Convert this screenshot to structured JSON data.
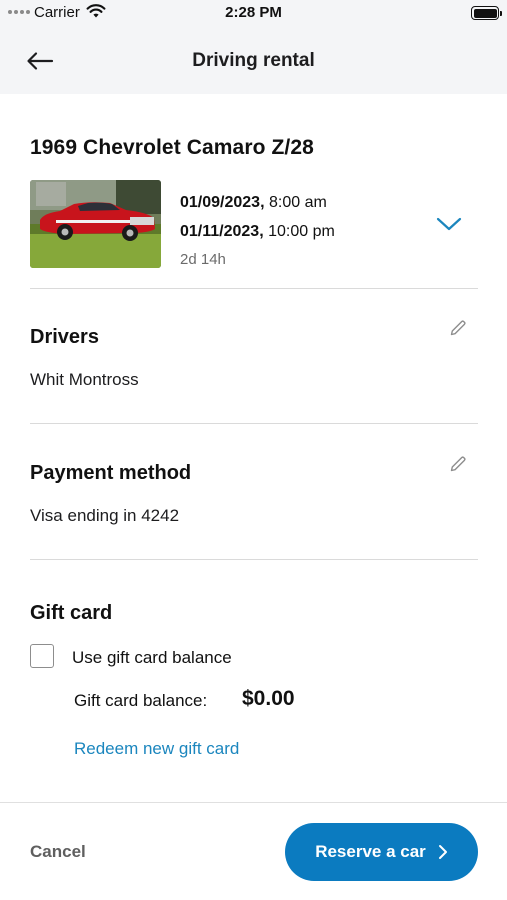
{
  "status_bar": {
    "carrier": "Carrier",
    "time": "2:28 PM"
  },
  "nav": {
    "title": "Driving rental",
    "back_icon": "arrow-left-icon"
  },
  "rental": {
    "car_name": "1969 Chevrolet Camaro Z/28",
    "pickup_date": "01/09/2023,",
    "pickup_time": " 8:00 am",
    "return_date": "01/11/2023,",
    "return_time": " 10:00 pm",
    "duration": "2d 14h",
    "expand_icon": "chevron-down-icon"
  },
  "drivers": {
    "title": "Drivers",
    "value": "Whit Montross",
    "edit_icon": "pencil-icon"
  },
  "payment": {
    "title": "Payment method",
    "value": "Visa ending in 4242",
    "edit_icon": "pencil-icon"
  },
  "gift_card": {
    "title": "Gift card",
    "use_balance_label": "Use gift card balance",
    "use_balance_checked": false,
    "balance_label": "Gift card balance:",
    "balance_value": "$0.00",
    "redeem_label": "Redeem new gift card"
  },
  "footer": {
    "cancel_label": "Cancel",
    "reserve_label": "Reserve a car",
    "reserve_icon": "chevron-right-icon"
  },
  "colors": {
    "accent": "#0b7bc0",
    "link": "#1b86be",
    "nav_background": "#f4f5f7",
    "divider": "#dadada"
  }
}
